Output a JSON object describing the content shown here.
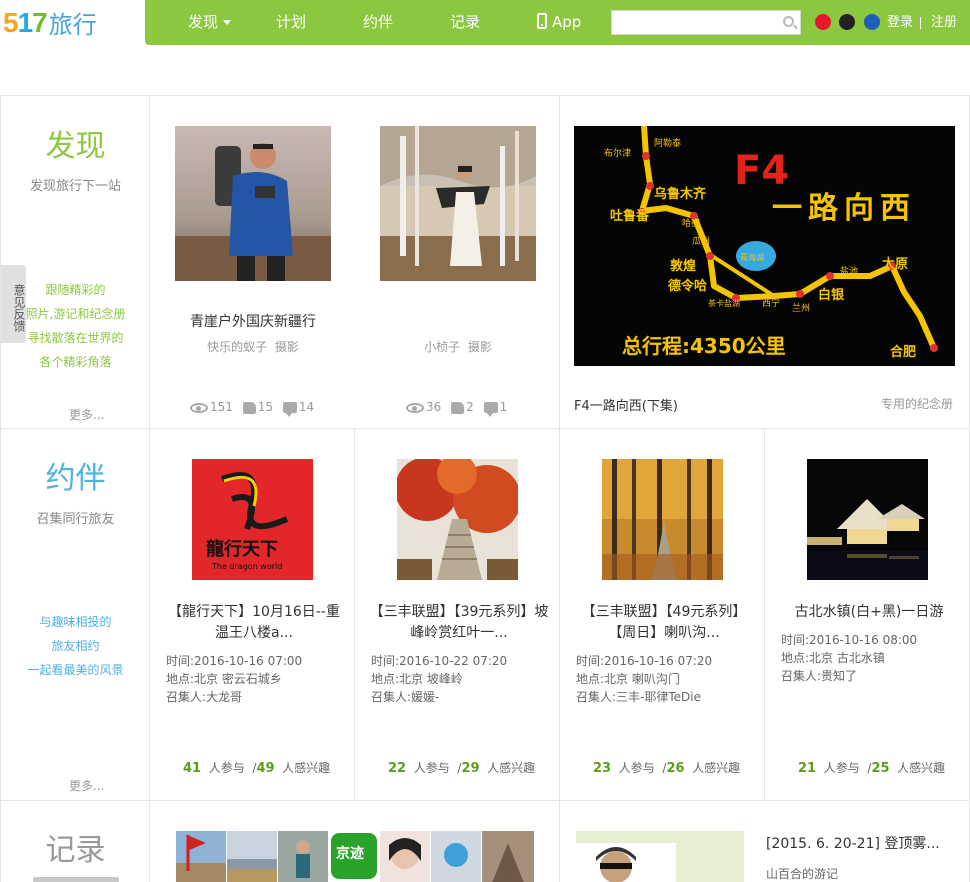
{
  "logo": {
    "number": "517",
    "text": "旅行"
  },
  "nav": {
    "items": [
      "发现",
      "计划",
      "约伴",
      "记录",
      "App"
    ],
    "login": "登录",
    "separator": "|",
    "register": "注册"
  },
  "colors": {
    "brand_green": "#8cc83f",
    "discover_green": "#8cc83f",
    "companion_blue": "#4fb0e6",
    "record_gray": "#999999",
    "count_green": "#5a9e1a"
  },
  "feedback": "意见反馈",
  "discover": {
    "title": "发现",
    "subtitle": "发现旅行下一站",
    "desc": [
      "跟随精彩的",
      "照片,游记和纪念册",
      "寻找散落在世界的",
      "各个精彩角落"
    ],
    "more": "更多...",
    "cards": [
      {
        "title": "青崖户外国庆新疆行",
        "author": "快乐的蚁子",
        "action": "摄影",
        "views": "151",
        "likes": "15",
        "comments": "14"
      },
      {
        "title": "",
        "author": "小桢子",
        "action": "摄影",
        "views": "36",
        "likes": "2",
        "comments": "1"
      }
    ],
    "album": {
      "map_title": "F4",
      "map_slogan": "一路向西",
      "map_total": "总行程:4350公里",
      "cities": [
        "布尔津",
        "阿勒泰",
        "乌鲁木齐",
        "吐鲁番",
        "哈密",
        "瓜州",
        "敦煌",
        "德令哈",
        "青海湖",
        "茶卡盐湖",
        "西宁",
        "兰州",
        "白银",
        "盐池",
        "太原",
        "合肥"
      ],
      "caption": "F4一路向西(下集)",
      "link": "专用的纪念册"
    }
  },
  "companion": {
    "title": "约伴",
    "subtitle": "召集同行旅友",
    "desc": [
      "与趣味相投的",
      "旅友相约",
      "一起看最美的风景"
    ],
    "more": "更多...",
    "logo_text": "龍行天下",
    "logo_sub": "The dragon world",
    "events": [
      {
        "title": "【龍行天下】10月16日--重温王八楼a...",
        "time": "时间:2016-10-16 07:00",
        "place": "地点:北京 密云石城乡",
        "host": "召集人:大龙哥",
        "joined": "41",
        "joined_label": "人参与",
        "sep": "/",
        "interested": "49",
        "interested_label": "人感兴趣"
      },
      {
        "title": "【三丰联盟】【39元系列】坡峰岭赏红叶一...",
        "time": "时间:2016-10-22 07:20",
        "place": "地点:北京 坡峰岭",
        "host": "召集人:媛媛-",
        "joined": "22",
        "joined_label": "人参与",
        "sep": "/",
        "interested": "29",
        "interested_label": "人感兴趣"
      },
      {
        "title": "【三丰联盟】【49元系列】【周日】喇叭沟...",
        "time": "时间:2016-10-16 07:20",
        "place": "地点:北京 喇叭沟门",
        "host": "召集人:三丰-耶律TeDie",
        "joined": "23",
        "joined_label": "人参与",
        "sep": "/",
        "interested": "26",
        "interested_label": "人感兴趣"
      },
      {
        "title": "古北水镇(白+黑)一日游",
        "time": "时间:2016-10-16 08:00",
        "place": "地点:北京 古北水镇",
        "host": "召集人:贵知了",
        "joined": "21",
        "joined_label": "人参与",
        "sep": "/",
        "interested": "25",
        "interested_label": "人感兴趣"
      }
    ]
  },
  "record": {
    "title": "记录",
    "thumb_badge": "京迹",
    "journal_title": "[2015. 6. 20-21] 登顶雾...",
    "journal_author": "山百合的游记"
  }
}
